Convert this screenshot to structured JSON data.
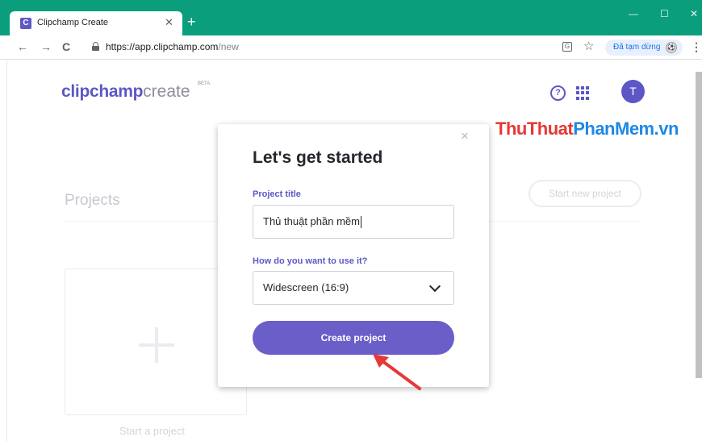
{
  "browser": {
    "tab_favicon": "C",
    "tab_title": "Clipchamp Create",
    "tab_close": "✕",
    "new_tab": "+",
    "window_controls": {
      "minimize": "—",
      "maximize": "☐",
      "close": "✕"
    },
    "nav": {
      "back": "←",
      "forward": "→",
      "reload": "C"
    },
    "url_host": "https://app.clipchamp.com",
    "url_path": "/new",
    "paused_label": "Đã tạm dừng",
    "menu_glyph": "⋮",
    "star_glyph": "☆",
    "translate_glyph": "G",
    "accent_color": "#0b9e7c"
  },
  "app": {
    "logo_main": "clipchamp",
    "logo_sub": "create",
    "logo_beta": "BETA",
    "help_glyph": "?",
    "avatar_letter": "T",
    "brand_color": "#5c57c5"
  },
  "watermark": {
    "part1": "ThuThuat",
    "part2": "PhanMem.vn"
  },
  "background": {
    "projects_heading": "Projects",
    "start_new_project": "Start new project",
    "start_card_label": "Start a project"
  },
  "modal": {
    "close_glyph": "×",
    "title": "Let's get started",
    "project_title_label": "Project title",
    "project_title_value": "Thủ thuật phần mềm",
    "usage_label": "How do you want to use it?",
    "usage_value": "Widescreen (16:9)",
    "create_button": "Create project",
    "button_color": "#6a5ec8"
  },
  "annotation": {
    "arrow_color": "#e53935"
  }
}
